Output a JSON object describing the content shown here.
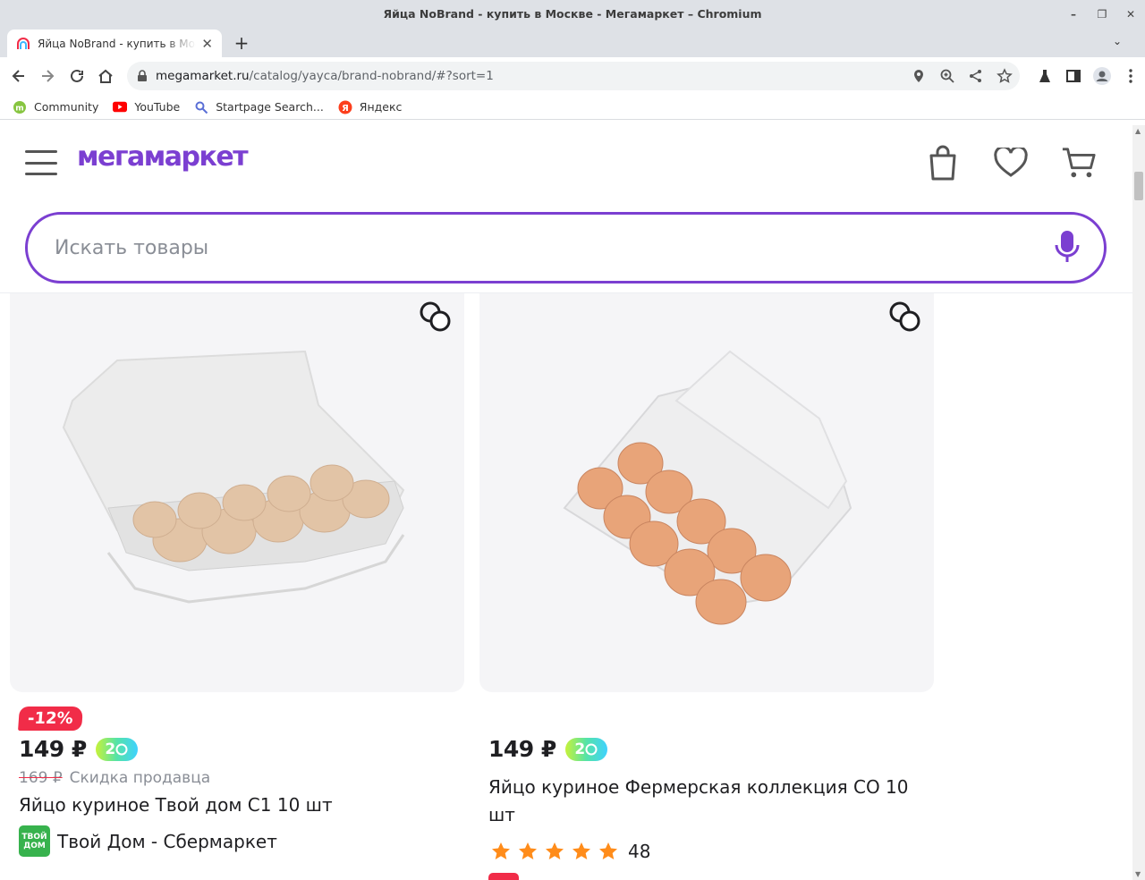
{
  "window": {
    "title": "Яйца NoBrand - купить в Москве - Мегамаркет – Chromium"
  },
  "tab": {
    "title": "Яйца NoBrand - купить в Москве - Мегамаркет"
  },
  "address": {
    "host": "megamarket.ru",
    "path": "/catalog/yayca/brand-nobrand/#?sort=1"
  },
  "bookmarks": [
    {
      "label": "Community",
      "icon": "mint-icon"
    },
    {
      "label": "YouTube",
      "icon": "youtube-icon"
    },
    {
      "label": "Startpage Search...",
      "icon": "startpage-icon"
    },
    {
      "label": "Яндекс",
      "icon": "yandex-icon"
    }
  ],
  "site": {
    "logo": "мегамаркет",
    "search_placeholder": "Искать товары"
  },
  "products": [
    {
      "discount": "-12%",
      "price": "149 ₽",
      "bonus": "2",
      "old_price": "169 ₽",
      "old_note": "Скидка продавца",
      "name": "Яйцо куриное Твой дом С1 10 шт",
      "seller": "Твой Дом - Сбермаркет",
      "seller_logo": "ТВОЙ ДОМ"
    },
    {
      "price": "149 ₽",
      "bonus": "2",
      "name": "Яйцо куриное Фермерская коллекция СО 10 шт",
      "rating": 5,
      "reviews": "48"
    }
  ],
  "colors": {
    "brand": "#7b3fd1",
    "discount": "#f12c48",
    "star": "#ff8c1a"
  }
}
